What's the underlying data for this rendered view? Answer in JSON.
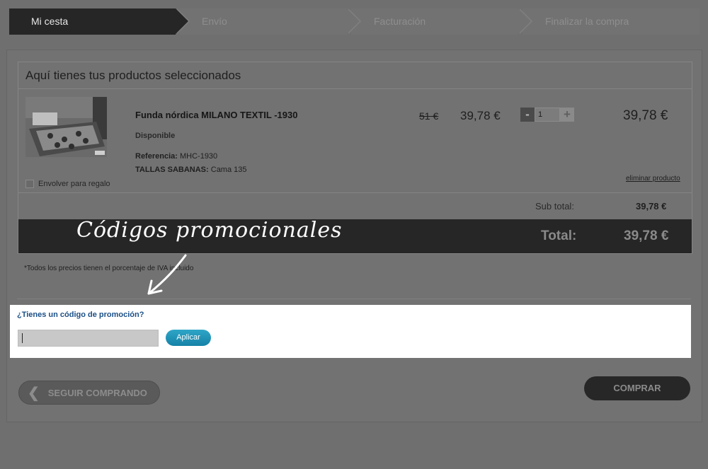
{
  "steps": [
    {
      "label": "Mi cesta"
    },
    {
      "label": "Envío"
    },
    {
      "label": "Facturación"
    },
    {
      "label": "Finalizar la compra"
    }
  ],
  "cart": {
    "title": "Aquí tienes tus productos seleccionados",
    "product": {
      "name": "Funda nórdica MILANO TEXTIL -1930",
      "status": "Disponible",
      "ref_label": "Referencia:",
      "ref_value": "MHC-1930",
      "size_label": "TALLAS SABANAS:",
      "size_value": "Cama 135",
      "old_price": "51 €",
      "price": "39,78 €",
      "quantity": "1",
      "line_total": "39,78 €",
      "remove_label": "eliminar producto",
      "gift_label": "Envolver para regalo"
    },
    "qty_minus": "-",
    "qty_plus": "+",
    "subtotal_label": "Sub total:",
    "subtotal_value": "39,78 €",
    "total_label": "Total:",
    "total_value": "39,78 €",
    "vat_note": "*Todos los precios tienen el porcentaje de IVA incluido"
  },
  "annotation": "Códigos promocionales",
  "promo": {
    "title": "¿Tienes un código de promoción?",
    "input_value": "",
    "apply_label": "Aplicar"
  },
  "actions": {
    "back_label": "SEGUIR COMPRANDO",
    "buy_label": "COMPRAR"
  },
  "colors": {
    "promo_link": "#1b4f86",
    "apply_button": "#1c93b8",
    "highlight": "#ffffff"
  }
}
